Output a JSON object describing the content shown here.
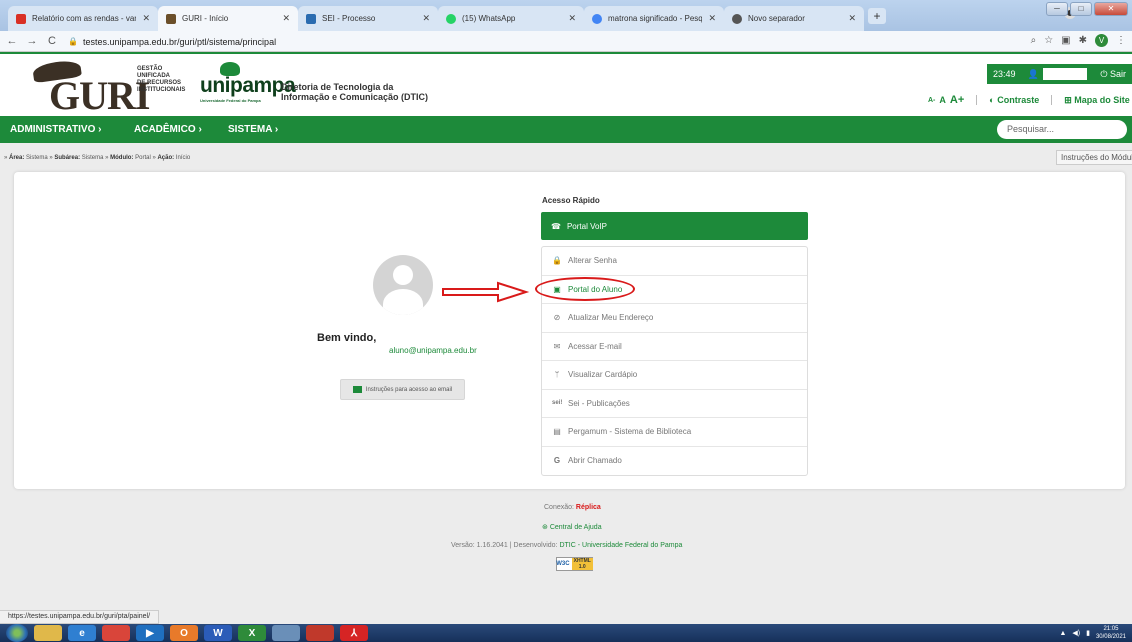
{
  "browser": {
    "tabs": [
      {
        "label": "Relatório com as rendas - vanus",
        "icon": "gmail-icon",
        "color": "#d93025"
      },
      {
        "label": "GURI - Início",
        "icon": "guri-icon",
        "color": "#6b4f2a"
      },
      {
        "label": "SEI - Processo",
        "icon": "sei-icon",
        "color": "#2b6cb0"
      },
      {
        "label": "(15) WhatsApp",
        "icon": "whatsapp-icon",
        "color": "#25d366"
      },
      {
        "label": "matrona significado - Pesquisa G",
        "icon": "google-icon",
        "color": "#4285f4"
      },
      {
        "label": "Novo separador",
        "icon": "chrome-icon",
        "color": "#555555"
      }
    ],
    "url": "testes.unipampa.edu.br/guri/ptl/sistema/principal",
    "profile_initial": "V"
  },
  "header": {
    "logo_text": "GURI",
    "logo_subtitle": [
      "GESTÃO",
      "UNIFICADA",
      "DE RECURSOS",
      "INSTITUCIONAIS"
    ],
    "uni_logo": "unipampa",
    "uni_caption": "Universidade Federal do Pampa",
    "dtic_line1": "Diretoria de Tecnologia da",
    "dtic_line2": "Informação e Comunicação (DTIC)",
    "time": "23:49",
    "logout": "Sair",
    "font_small": "A-",
    "font_normal": "A",
    "font_large": "A+",
    "contrast": "Contraste",
    "sitemap": "Mapa do Site"
  },
  "menu": {
    "items": [
      "ADMINISTRATIVO ›",
      "ACADÊMICO ›",
      "SISTEMA ›"
    ],
    "search_placeholder": "Pesquisar..."
  },
  "breadcrumb": {
    "area_label": "Área:",
    "area": "Sistema",
    "subarea_label": "Subárea:",
    "subarea": "Sistema",
    "module_label": "Módulo:",
    "module": "Portal",
    "action_label": "Ação:",
    "action": "Início"
  },
  "instructions_button": "Instruções do Módulo",
  "profile": {
    "welcome": "Bem vindo,",
    "email": "aluno@unipampa.edu.br",
    "email_instructions": "Instruções para acesso ao email"
  },
  "quick_access": {
    "title": "Acesso Rápido",
    "primary": "Portal VoIP",
    "items": [
      {
        "label": "Alterar Senha",
        "icon": "lock-icon"
      },
      {
        "label": "Portal do Aluno",
        "icon": "student-icon"
      },
      {
        "label": "Atualizar Meu Endereço",
        "icon": "address-icon"
      },
      {
        "label": "Acessar E-mail",
        "icon": "envelope-icon"
      },
      {
        "label": "Visualizar Cardápio",
        "icon": "cutlery-icon"
      },
      {
        "label": "Sei - Publicações",
        "icon": "sei-icon"
      },
      {
        "label": "Pergamum - Sistema de Biblioteca",
        "icon": "book-icon"
      },
      {
        "label": "Abrir Chamado",
        "icon": "g-icon"
      }
    ]
  },
  "footer": {
    "connection_label": "Conexão:",
    "connection_value": "Réplica",
    "help": "Central de Ajuda",
    "version_prefix": "Versão: 1.16.2041 | Desenvolvido:",
    "developer": "DTIC - Universidade Federal do Pampa",
    "w3c_label": "W3C",
    "w3c_badge": "XHTML 1.0"
  },
  "status_url": "https://testes.unipampa.edu.br/guri/pta/painel/",
  "taskbar": {
    "clock_time": "21:05",
    "clock_date": "30/08/2021"
  },
  "colors": {
    "brand_green": "#1d8a3a",
    "highlight_red": "#d91a1a"
  }
}
